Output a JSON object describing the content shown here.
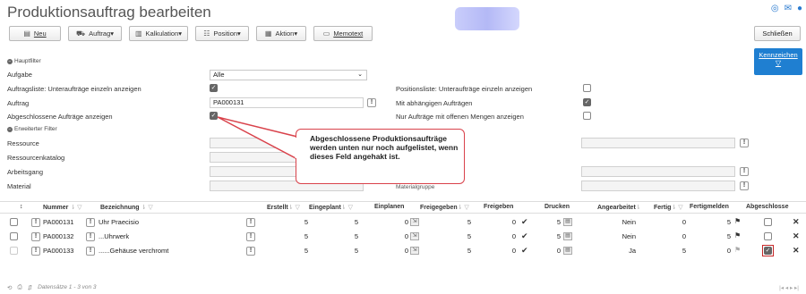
{
  "title": "Produktionsauftrag bearbeiten",
  "top_icons": [
    "globe-icon",
    "mail-icon",
    "help-icon"
  ],
  "toolbar": [
    {
      "icon": "document-icon",
      "label": "Neu"
    },
    {
      "icon": "car-icon",
      "label": "Auftrag▾"
    },
    {
      "icon": "chart-icon",
      "label": "Kalkulation▾"
    },
    {
      "icon": "position-icon",
      "label": "Position▾"
    },
    {
      "icon": "calendar-icon",
      "label": "Aktion▾"
    },
    {
      "icon": "memo-icon",
      "label": "Memotext"
    }
  ],
  "close_label": "Schließen",
  "kennzeichen": {
    "label": "Kennzeichen",
    "icon": "filter-icon"
  },
  "hauptfilter": {
    "title": "Hauptfilter",
    "aufgabe_label": "Aufgabe",
    "aufgabe_value": "Alle",
    "auftragsliste_label": "Auftragsliste: Unteraufträge einzeln anzeigen",
    "auftrag_label": "Auftrag",
    "auftrag_value": "PA000131",
    "abgeschlossene_label": "Abgeschlossene Aufträge anzeigen",
    "positionsliste_label": "Positionsliste: Unteraufträge einzeln anzeigen",
    "abhaengige_label": "Mit abhängigen Aufträgen",
    "offene_label": "Nur Aufträge mit offenen Mengen anzeigen"
  },
  "erweitert": {
    "title": "Erweiterter Filter",
    "ressource_label": "Ressource",
    "ressourcenkatalog_label": "Ressourcenkatalog",
    "arbeitsgang_label": "Arbeitsgang",
    "material_label": "Material",
    "materialgruppe_label": "Materialgruppe"
  },
  "callout": "Abgeschlossene Produktionsaufträge werden unten nur noch aufgelistet, wenn dieses Feld angehakt ist.",
  "table": {
    "headers": {
      "nummer": "Nummer",
      "bezeichnung": "Bezeichnung",
      "erstellt": "Erstellt",
      "eingeplant": "Eingeplant",
      "einplanen": "Einplanen",
      "freigegeben": "Freigegeben",
      "freigeben": "Freigeben",
      "drucken": "Drucken",
      "angearbeitet": "Angearbeitet",
      "fertig": "Fertig",
      "fertigmelden": "Fertigmelden",
      "abgeschlossen": "Abgeschlosse"
    },
    "rows": [
      {
        "nummer": "PA000131",
        "bez": "Uhr Praecisio",
        "erstellt": "5",
        "eingeplant": "5",
        "einplanen": "0",
        "freigegeben": "5",
        "freigeben": "0",
        "drucken": "5",
        "angearbeitet": "Nein",
        "fertig": "0",
        "fertigmelden": "5"
      },
      {
        "nummer": "PA000132",
        "bez": "...Uhrwerk",
        "erstellt": "5",
        "eingeplant": "5",
        "einplanen": "0",
        "freigegeben": "5",
        "freigeben": "0",
        "drucken": "5",
        "angearbeitet": "Nein",
        "fertig": "0",
        "fertigmelden": "5"
      },
      {
        "nummer": "PA000133",
        "bez": "......Gehäuse verchromt",
        "erstellt": "5",
        "eingeplant": "5",
        "einplanen": "0",
        "freigegeben": "5",
        "freigeben": "0",
        "drucken": "0",
        "angearbeitet": "Ja",
        "fertig": "5",
        "fertigmelden": "0"
      }
    ]
  },
  "footer": {
    "records": "Datensätze 1 - 3 von 3",
    "pager": "|◂  ◂  ▸  ▸|"
  }
}
